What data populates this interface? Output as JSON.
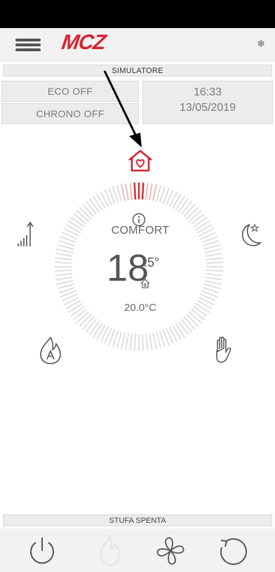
{
  "header": {
    "logo_text": "MCZ",
    "menu_icon": "menu-icon",
    "right_icon": "snowflake-icon",
    "right_glyph": "❄"
  },
  "simulator_label": "SIMULATORE",
  "modes": {
    "eco": "ECO OFF",
    "chrono": "CHRONO OFF"
  },
  "clock": {
    "time": "16:33",
    "date": "13/05/2019"
  },
  "dial": {
    "mode": "COMFORT",
    "temperature_int": "18",
    "temperature_dec": ".5°",
    "setpoint": "20.0°C",
    "accent_color": "#d9232e"
  },
  "icons": {
    "top": "house-heart-icon",
    "left_top": "signal-power-icon",
    "right_top": "moon-star-icon",
    "left_bottom": "auto-flame-icon",
    "right_bottom": "hand-icon"
  },
  "stove_status": "STUFA SPENTA",
  "bottom_buttons": [
    "power-icon",
    "flame-icon",
    "fan-icon",
    "refresh-icon"
  ]
}
